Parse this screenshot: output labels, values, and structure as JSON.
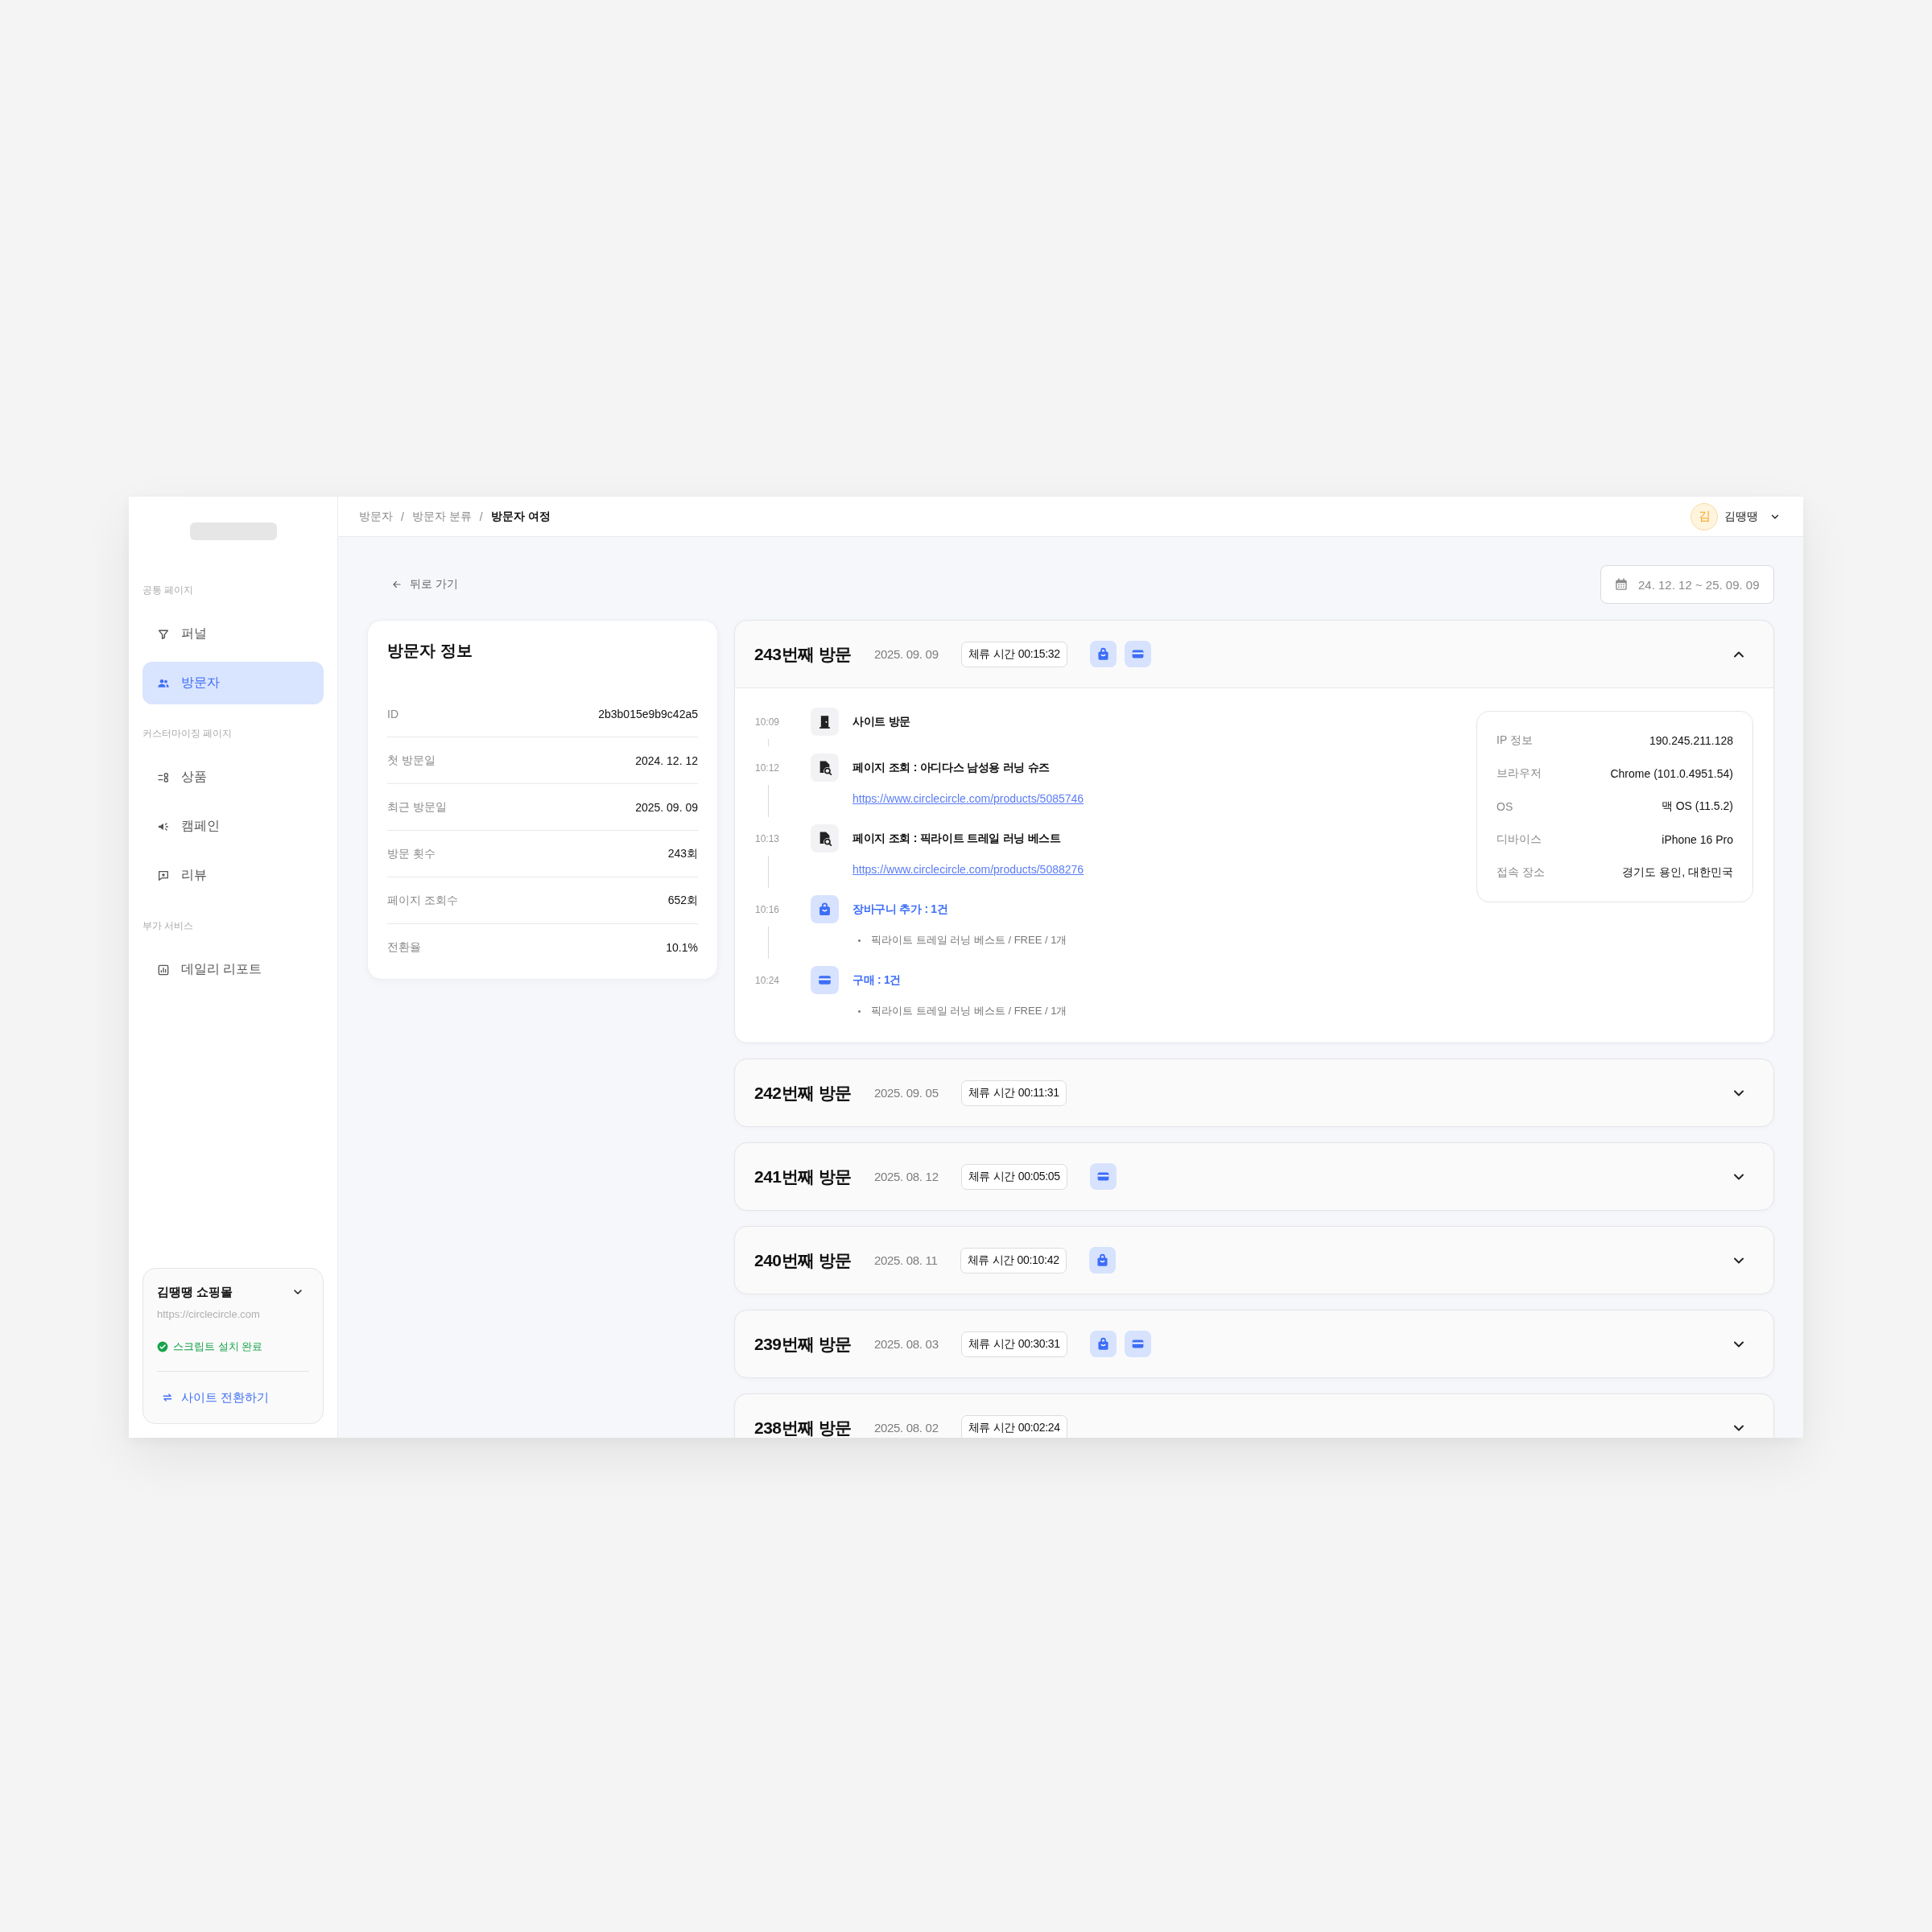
{
  "header": {
    "breadcrumb": {
      "separator": "/",
      "items": [
        {
          "label": "방문자",
          "current": false
        },
        {
          "label": "방문자 분류",
          "current": false
        },
        {
          "label": "방문자 여정",
          "current": true
        }
      ]
    },
    "user": {
      "initial": "김",
      "name": "김땡땡"
    }
  },
  "sidebar": {
    "sections": [
      {
        "title": "공통 페이지",
        "items": [
          {
            "label": "퍼널",
            "selected": false
          },
          {
            "label": "방문자",
            "selected": true
          }
        ]
      },
      {
        "title": "커스터마이징 페이지",
        "items": [
          {
            "label": "상품",
            "selected": false
          },
          {
            "label": "캠페인",
            "selected": false
          },
          {
            "label": "리뷰",
            "selected": false
          }
        ]
      },
      {
        "title": "부가 서비스",
        "items": [
          {
            "label": "데일리 리포트",
            "selected": false
          }
        ]
      }
    ],
    "site": {
      "name": "김땡땡 쇼핑몰",
      "url": "https://circlecircle.com",
      "status": "스크립트 설치 완료",
      "action": "사이트 전환하기"
    }
  },
  "toolbar": {
    "back": "뒤로 가기",
    "date_range": "24. 12. 12 ~ 25. 09. 09"
  },
  "visitor_info": {
    "title": "방문자 정보",
    "rows": [
      {
        "label": "ID",
        "value": "2b3b015e9b9c42a5"
      },
      {
        "label": "첫 방문일",
        "value": "2024. 12. 12"
      },
      {
        "label": "최근 방문일",
        "value": "2025. 09. 09"
      },
      {
        "label": "방문 횟수",
        "value": "243회"
      },
      {
        "label": "페이지 조회수",
        "value": "652회"
      },
      {
        "label": "전환율",
        "value": "10.1%"
      }
    ]
  },
  "visits": [
    {
      "title": "243번째 방문",
      "date": "2025. 09. 09",
      "duration": "체류 시간 00:15:32",
      "has_cart": true,
      "has_purchase": true,
      "expanded": true,
      "timeline": [
        {
          "kind": "visit",
          "time": "10:09",
          "title": "사이트 방문"
        },
        {
          "kind": "page_view",
          "time": "10:12",
          "title": "페이지 조회 : 아디다스 남성용 러닝 슈즈",
          "url": "https://www.circlecircle.com/products/5085746"
        },
        {
          "kind": "page_view",
          "time": "10:13",
          "title": "페이지 조회 : 픽라이트 트레일 러닝 베스트",
          "url": "https://www.circlecircle.com/products/5088276"
        },
        {
          "kind": "cart",
          "time": "10:16",
          "title": "장바구니 추가 : 1건",
          "items": [
            "픽라이트 트레일 러닝 베스트 / FREE / 1개"
          ]
        },
        {
          "kind": "purchase",
          "time": "10:24",
          "title": "구매 : 1건",
          "items": [
            "픽라이트 트레일 러닝 베스트 / FREE / 1개"
          ]
        }
      ],
      "session_info": [
        {
          "label": "IP 정보",
          "value": "190.245.211.128"
        },
        {
          "label": "브라우저",
          "value": "Chrome (101.0.4951.54)"
        },
        {
          "label": "OS",
          "value": "맥 OS (11.5.2)"
        },
        {
          "label": "디바이스",
          "value": "iPhone 16 Pro"
        },
        {
          "label": "접속 장소",
          "value": "경기도 용인, 대한민국"
        }
      ]
    },
    {
      "title": "242번째 방문",
      "date": "2025. 09. 05",
      "duration": "체류 시간 00:11:31",
      "has_cart": false,
      "has_purchase": false,
      "expanded": false
    },
    {
      "title": "241번째 방문",
      "date": "2025. 08. 12",
      "duration": "체류 시간 00:05:05",
      "has_cart": false,
      "has_purchase": true,
      "expanded": false
    },
    {
      "title": "240번째 방문",
      "date": "2025. 08. 11",
      "duration": "체류 시간 00:10:42",
      "has_cart": true,
      "has_purchase": false,
      "expanded": false
    },
    {
      "title": "239번째 방문",
      "date": "2025. 08. 03",
      "duration": "체류 시간 00:30:31",
      "has_cart": true,
      "has_purchase": true,
      "expanded": false
    },
    {
      "title": "238번째 방문",
      "date": "2025. 08. 02",
      "duration": "체류 시간 00:02:24",
      "has_cart": false,
      "has_purchase": false,
      "expanded": false
    }
  ]
}
